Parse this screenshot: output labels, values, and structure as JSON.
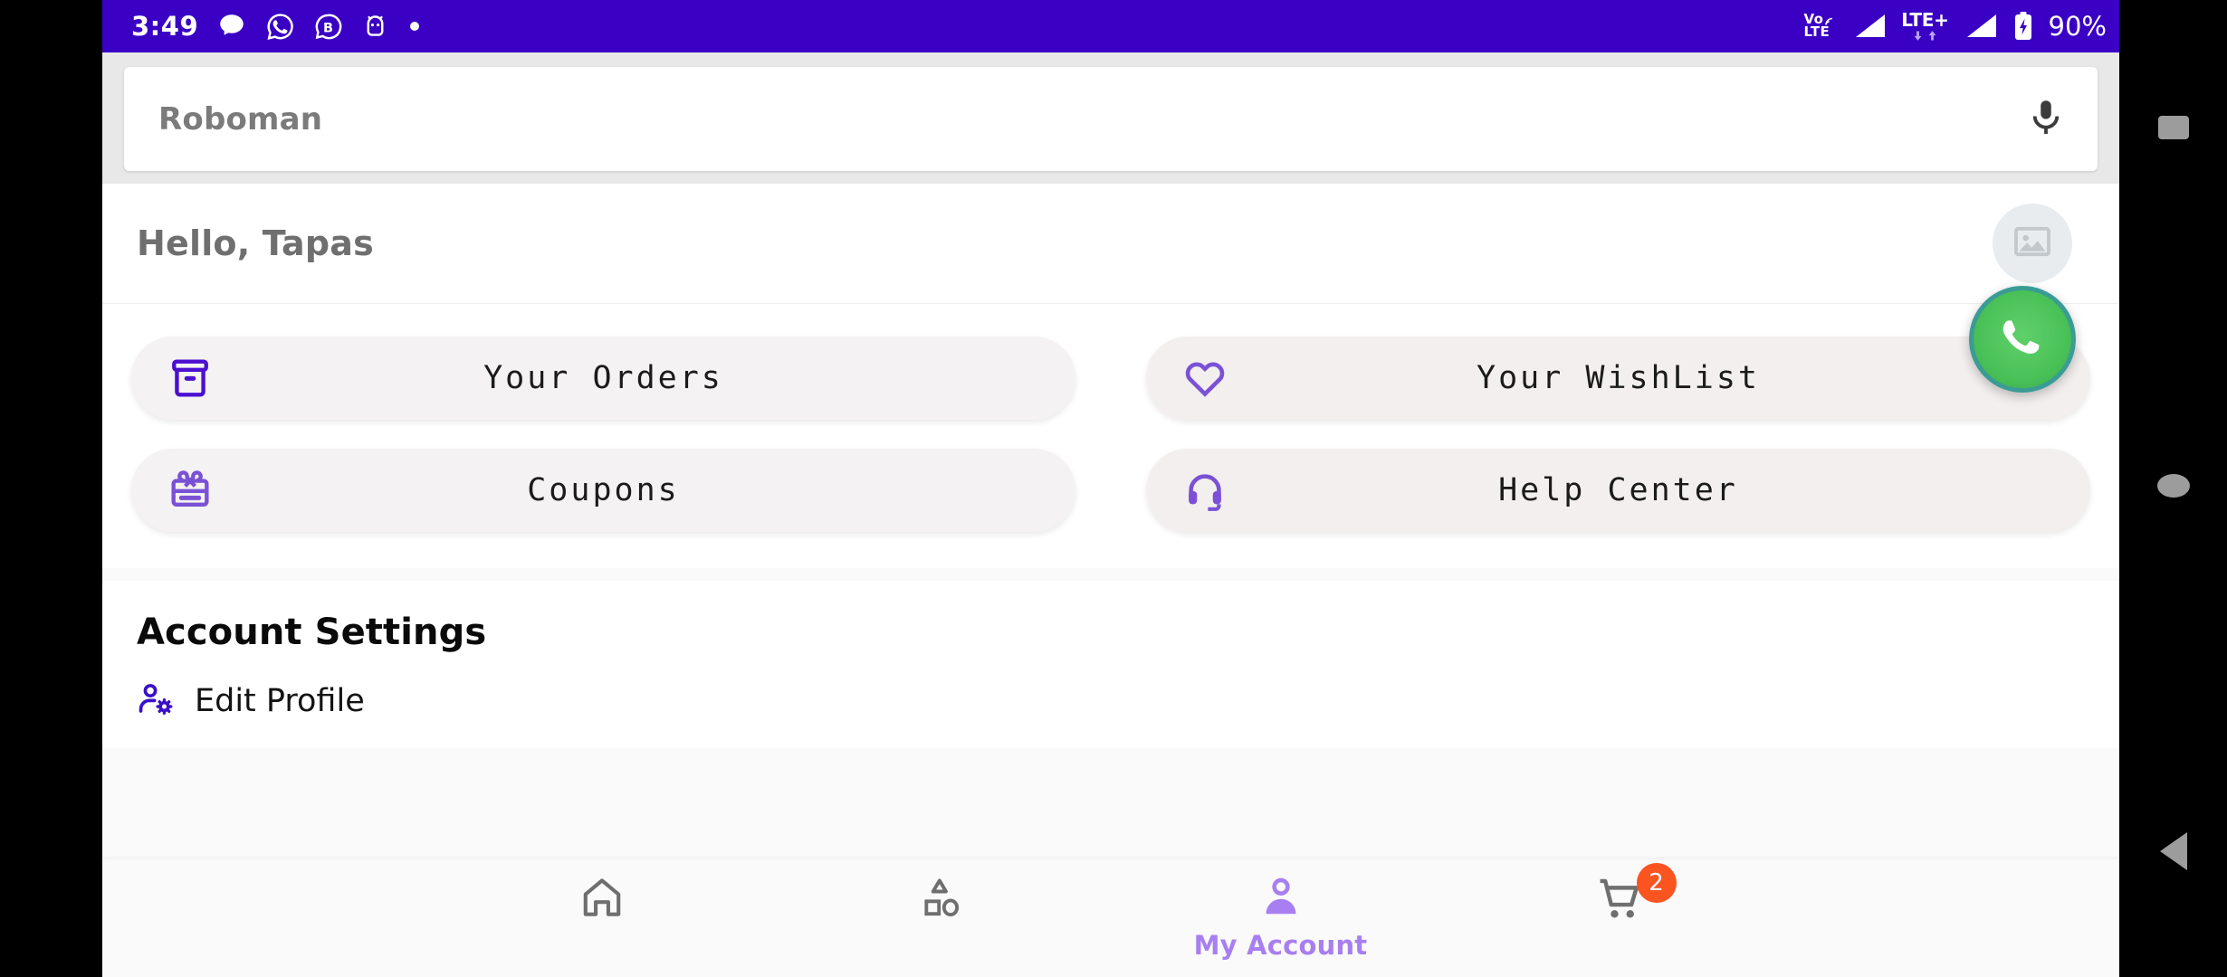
{
  "status_bar": {
    "time": "3:49",
    "icons_left": [
      "message-bubble-icon",
      "whatsapp-icon",
      "bigo-b-icon",
      "android-robot-icon",
      "dot-icon"
    ],
    "volte_label_top": "Vo",
    "volte_label_bottom": "LTE",
    "network_label": "LTE+",
    "battery_percent": "90%",
    "accent": "#3a00c4"
  },
  "search": {
    "value": "Roboman",
    "placeholder": "Roboman",
    "mic_icon": "microphone-icon"
  },
  "greeting": {
    "text": "Hello, Tapas",
    "avatar_icon": "image-placeholder-icon"
  },
  "quick_actions": [
    {
      "label": "Your Orders",
      "icon": "archive-box-icon",
      "side": "left"
    },
    {
      "label": "Your WishList",
      "icon": "heart-icon",
      "side": "right"
    },
    {
      "label": "Coupons",
      "icon": "gift-card-icon",
      "side": "left"
    },
    {
      "label": "Help Center",
      "icon": "headset-icon",
      "side": "right"
    }
  ],
  "floating_action": {
    "name": "whatsapp-support-button",
    "icon": "whatsapp-icon",
    "color": "#49c157"
  },
  "account_settings": {
    "title": "Account Settings",
    "rows": [
      {
        "label": "Edit Profile",
        "icon": "user-gear-icon"
      }
    ]
  },
  "bottom_nav": {
    "items": [
      {
        "label": "",
        "icon": "home-icon",
        "active": false
      },
      {
        "label": "",
        "icon": "category-icon",
        "active": false
      },
      {
        "label": "My Account",
        "icon": "person-icon",
        "active": true
      },
      {
        "label": "",
        "icon": "cart-icon",
        "active": false,
        "badge": "2"
      }
    ],
    "active_color": "#a87ff0",
    "badge_color": "#fa5421"
  },
  "system_nav": {
    "buttons": [
      {
        "name": "recents-button",
        "icon": "square-icon"
      },
      {
        "name": "home-button",
        "icon": "circle-icon"
      },
      {
        "name": "back-button",
        "icon": "triangle-left-icon"
      }
    ]
  },
  "theme": {
    "primary": "#4b0fd0",
    "card_left": "#f4f2f2",
    "card_right": "#f2efee"
  }
}
